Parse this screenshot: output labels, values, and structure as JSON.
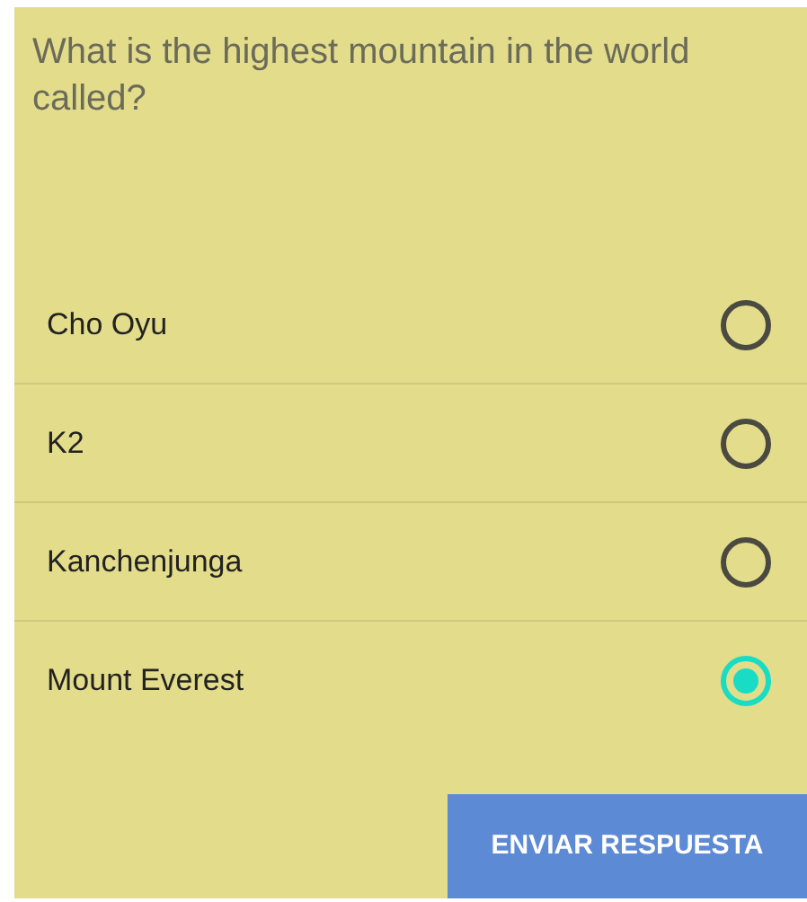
{
  "question": "What is the highest mountain in the world called?",
  "options": [
    {
      "label": "Cho Oyu",
      "selected": false
    },
    {
      "label": "K2",
      "selected": false
    },
    {
      "label": "Kanchenjunga",
      "selected": false
    },
    {
      "label": "Mount Everest",
      "selected": true
    }
  ],
  "submit_button": "ENVIAR RESPUESTA"
}
